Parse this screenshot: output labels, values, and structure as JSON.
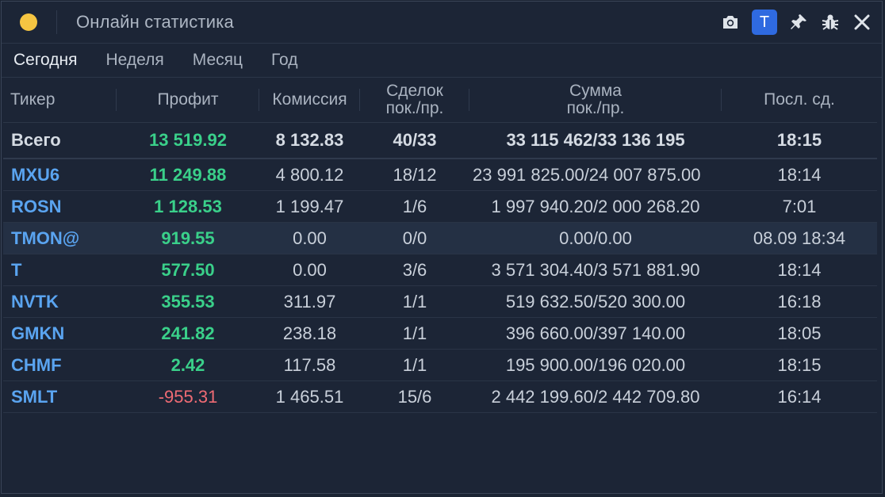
{
  "window": {
    "title": "Онлайн статистика",
    "badge_label": "T"
  },
  "tabs": [
    {
      "label": "Сегодня",
      "active": true
    },
    {
      "label": "Неделя",
      "active": false
    },
    {
      "label": "Месяц",
      "active": false
    },
    {
      "label": "Год",
      "active": false
    }
  ],
  "columns": {
    "ticker": "Тикер",
    "profit": "Профит",
    "commission": "Комиссия",
    "deals_line1": "Сделок",
    "deals_line2": "пок./пр.",
    "sum_line1": "Сумма",
    "sum_line2": "пок./пр.",
    "last": "Посл. сд."
  },
  "total": {
    "ticker": "Всего",
    "profit": "13 519.92",
    "commission": "8 132.83",
    "deals": "40/33",
    "sum": "33 115 462/33 136 195",
    "last": "18:15"
  },
  "rows": [
    {
      "ticker": "MXU6",
      "profit": "11 249.88",
      "commission": "4 800.12",
      "deals": "18/12",
      "sum": "23 991 825.00/24 007 875.00",
      "last": "18:14"
    },
    {
      "ticker": "ROSN",
      "profit": "1 128.53",
      "commission": "1 199.47",
      "deals": "1/6",
      "sum": "1 997 940.20/2 000 268.20",
      "last": "7:01"
    },
    {
      "ticker": "TMON@",
      "profit": "919.55",
      "commission": "0.00",
      "deals": "0/0",
      "sum": "0.00/0.00",
      "last": "08.09 18:34"
    },
    {
      "ticker": "T",
      "profit": "577.50",
      "commission": "0.00",
      "deals": "3/6",
      "sum": "3 571 304.40/3 571 881.90",
      "last": "18:14"
    },
    {
      "ticker": "NVTK",
      "profit": "355.53",
      "commission": "311.97",
      "deals": "1/1",
      "sum": "519 632.50/520 300.00",
      "last": "16:18"
    },
    {
      "ticker": "GMKN",
      "profit": "241.82",
      "commission": "238.18",
      "deals": "1/1",
      "sum": "396 660.00/397 140.00",
      "last": "18:05"
    },
    {
      "ticker": "CHMF",
      "profit": "2.42",
      "commission": "117.58",
      "deals": "1/1",
      "sum": "195 900.00/196 020.00",
      "last": "18:15"
    },
    {
      "ticker": "SMLT",
      "profit": "-955.31",
      "commission": "1 465.51",
      "deals": "15/6",
      "sum": "2 442 199.60/2 442 709.80",
      "last": "16:14"
    }
  ],
  "colors": {
    "background": "#1c2536",
    "ticker": "#5aa4f0",
    "profit_positive": "#3ad08a",
    "profit_negative": "#ef6b74",
    "badge": "#2f6ae0",
    "traffic_light": "#f5c542"
  },
  "icons": [
    "camera-icon",
    "pin-icon",
    "bug-icon",
    "close-icon"
  ]
}
